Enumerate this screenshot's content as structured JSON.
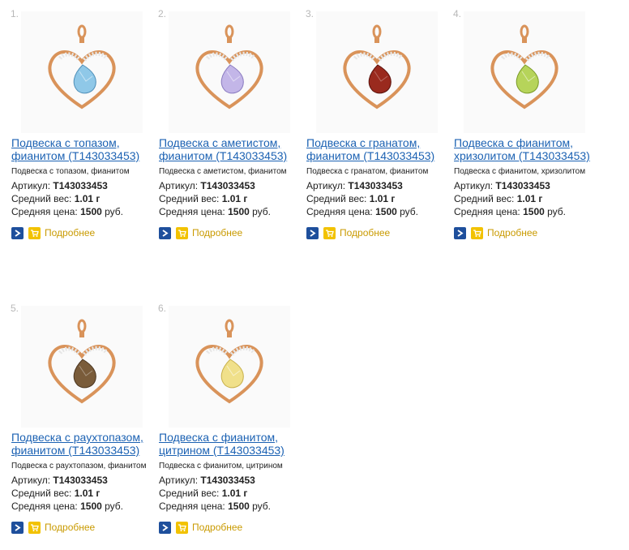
{
  "products": [
    {
      "number": "1.",
      "title_line1": "Подвеска с топазом,",
      "title_line2": "фианитом (Т143033453)",
      "subtitle": "Подвеска с топазом, фианитом",
      "article_label": "Артикул: ",
      "article": "Т143033453",
      "weight_label": "Средний вес: ",
      "weight": "1.01 г",
      "price_label": "Средняя цена: ",
      "price": "1500",
      "currency": " руб.",
      "more_label": "Подробнее",
      "stone_color": "#8fc8e8",
      "stone_dark": "#4f8fb8"
    },
    {
      "number": "2.",
      "title_line1": "Подвеска с аметистом,",
      "title_line2": "фианитом (Т143033453)",
      "subtitle": "Подвеска с аметистом, фианитом",
      "article_label": "Артикул: ",
      "article": "Т143033453",
      "weight_label": "Средний вес: ",
      "weight": "1.01 г",
      "price_label": "Средняя цена: ",
      "price": "1500",
      "currency": " руб.",
      "more_label": "Подробнее",
      "stone_color": "#c3b6e8",
      "stone_dark": "#8a7bc0"
    },
    {
      "number": "3.",
      "title_line1": "Подвеска с гранатом,",
      "title_line2": "фианитом (Т143033453)",
      "subtitle": "Подвеска с гранатом, фианитом",
      "article_label": "Артикул: ",
      "article": "Т143033453",
      "weight_label": "Средний вес: ",
      "weight": "1.01 г",
      "price_label": "Средняя цена: ",
      "price": "1500",
      "currency": " руб.",
      "more_label": "Подробнее",
      "stone_color": "#9a2a1e",
      "stone_dark": "#5a120c"
    },
    {
      "number": "4.",
      "title_line1": "Подвеска с фианитом,",
      "title_line2": "хризолитом (Т143033453)",
      "subtitle": "Подвеска с фианитом, хризолитом",
      "article_label": "Артикул: ",
      "article": "Т143033453",
      "weight_label": "Средний вес: ",
      "weight": "1.01 г",
      "price_label": "Средняя цена: ",
      "price": "1500",
      "currency": " руб.",
      "more_label": "Подробнее",
      "stone_color": "#b6d45a",
      "stone_dark": "#7a9a28"
    },
    {
      "number": "5.",
      "title_line1": "Подвеска с раухтопазом,",
      "title_line2": "фианитом (Т143033453)",
      "subtitle": "Подвеска с раухтопазом, фианитом",
      "article_label": "Артикул: ",
      "article": "Т143033453",
      "weight_label": "Средний вес: ",
      "weight": "1.01 г",
      "price_label": "Средняя цена: ",
      "price": "1500",
      "currency": " руб.",
      "more_label": "Подробнее",
      "stone_color": "#7a5c3a",
      "stone_dark": "#4a3520"
    },
    {
      "number": "6.",
      "title_line1": "Подвеска с фианитом,",
      "title_line2": "цитрином (Т143033453)",
      "subtitle": "Подвеска с фианитом, цитрином",
      "article_label": "Артикул: ",
      "article": "Т143033453",
      "weight_label": "Средний вес: ",
      "weight": "1.01 г",
      "price_label": "Средняя цена: ",
      "price": "1500",
      "currency": " руб.",
      "more_label": "Подробнее",
      "stone_color": "#f0e08a",
      "stone_dark": "#c8b04a"
    }
  ],
  "colors": {
    "link": "#1c62b3",
    "more_link": "#c99a00",
    "arrow_button": "#1e4f9c",
    "cart_button": "#f2c200",
    "gold": "#d9935a"
  },
  "icons": {
    "arrow": "chevron-right-icon",
    "cart": "cart-icon"
  }
}
